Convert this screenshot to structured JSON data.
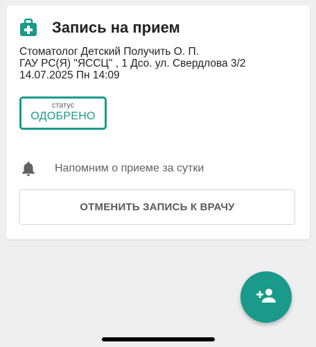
{
  "card": {
    "title": "Запись на прием",
    "header_icon": "medical-bag-icon",
    "details": [
      "Стоматолог Детский Получить О. П.",
      "ГАУ РС(Я) \"ЯССЦ\" , 1 Дсо. ул. Свердлова 3/2",
      "14.07.2025 Пн 14:09"
    ],
    "status": {
      "label": "статус",
      "value": "ОДОБРЕНО"
    },
    "reminder": {
      "icon": "bell-icon",
      "text": "Напомним о приеме за сутки"
    },
    "cancel_label": "ОТМЕНИТЬ ЗАПИСЬ К ВРАЧУ"
  },
  "fab": {
    "icon": "add-person-icon"
  },
  "colors": {
    "accent": "#1a9a8a",
    "background": "#efefef",
    "card": "#ffffff"
  }
}
